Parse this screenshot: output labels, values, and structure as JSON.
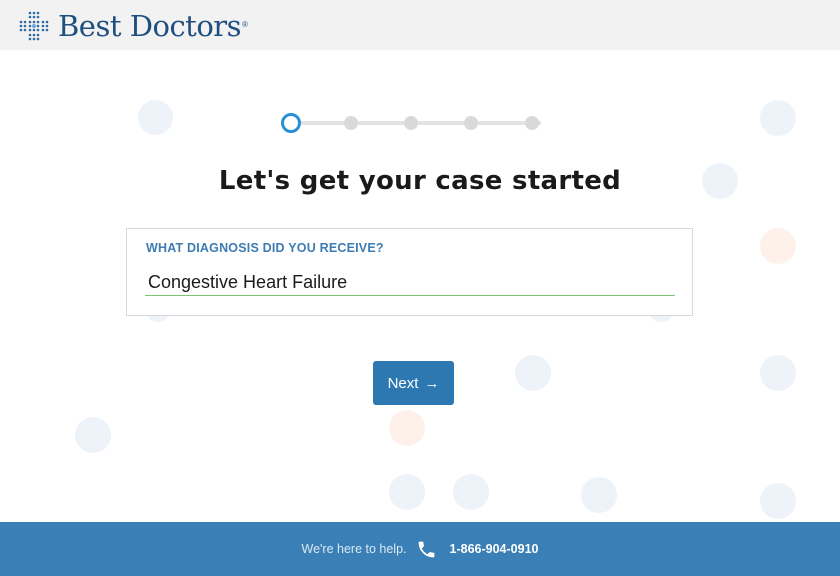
{
  "header": {
    "logo_text": "Best Doctors",
    "logo_registered": "®",
    "logo_icon": "dotted-cross-icon",
    "brand_color": "#1f4f80"
  },
  "stepper": {
    "total_steps": 5,
    "current_step": 1,
    "active_color": "#2b8fd6"
  },
  "main": {
    "title": "Let's get your case started",
    "diagnosis_field": {
      "label": "WHAT DIAGNOSIS DID YOU RECEIVE?",
      "value": "Congestive Heart Failure",
      "underline_color": "#7cc576"
    },
    "next_button": {
      "label": "Next",
      "icon": "arrow-right-icon",
      "color": "#2e78b2"
    }
  },
  "footer": {
    "help_text": "We're here to help.",
    "phone_icon": "phone-icon",
    "phone_number": "1-866-904-0910",
    "background": "#3a7fb5"
  }
}
